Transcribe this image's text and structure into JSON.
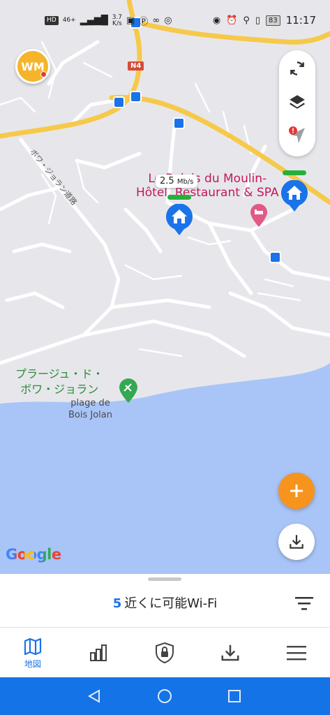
{
  "status_bar": {
    "network_chip": "HD",
    "signal_label": "46+",
    "speed_value": "3.7",
    "speed_unit": "K/s",
    "battery": "83",
    "time": "11:17"
  },
  "map": {
    "road_badge": "N4",
    "road_name": "ボワ・ジョラン道路",
    "poi_title_line1": "Le Relais du Moulin-",
    "poi_title_line2": "Hôtel, Restaurant & SPA",
    "speed_value": "2.5",
    "speed_unit": "Mb/s",
    "beach_jp_line1": "プラージュ・ド・",
    "beach_jp_line2": "ボワ・ジョラン",
    "beach_fr_line1": "plage de",
    "beach_fr_line2": "Bois Jolan",
    "attribution": "Google"
  },
  "colors": {
    "accent": "#1a73e8",
    "fab_orange": "#f7941d",
    "signal_green": "#26b03a",
    "poi_pink": "#c2185b",
    "water": "#a9c5f7",
    "nav_bar": "#1473e6"
  },
  "sheet": {
    "count": "5",
    "title": "近くに可能Wi-Fi"
  },
  "bottom_nav": {
    "items": [
      {
        "icon": "map-icon",
        "label": "地図",
        "active": true
      },
      {
        "icon": "stats-icon",
        "label": ""
      },
      {
        "icon": "vpn-lock-icon",
        "label": ""
      },
      {
        "icon": "download-icon",
        "label": ""
      },
      {
        "icon": "menu-icon",
        "label": ""
      }
    ]
  }
}
